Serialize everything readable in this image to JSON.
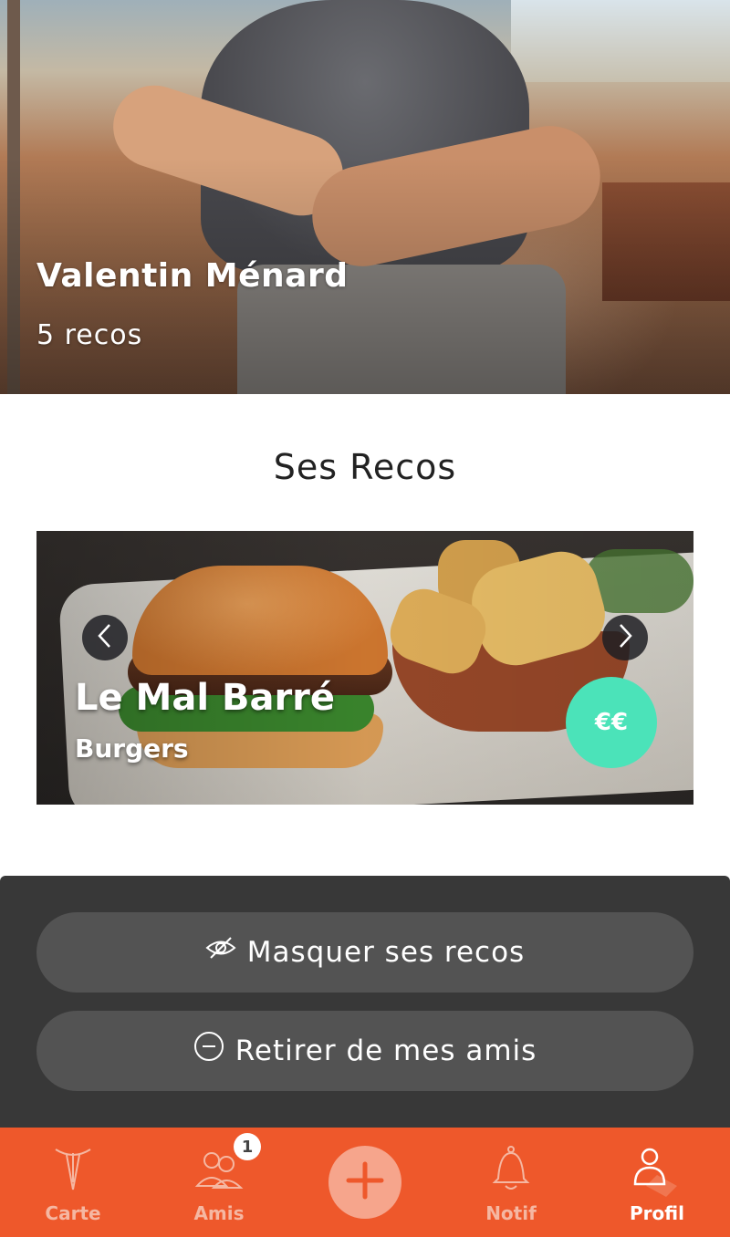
{
  "profile": {
    "name": "Valentin Ménard",
    "reco_count": "5 recos"
  },
  "section": {
    "title": "Ses Recos"
  },
  "recos": {
    "current": {
      "name": "Le Mal Barré",
      "category": "Burgers",
      "price": "€€"
    },
    "icons": {
      "prev": "chevron-left-icon",
      "next": "chevron-right-icon"
    }
  },
  "actions": {
    "hide_label": "Masquer ses recos",
    "remove_label": "Retirer de mes amis",
    "hide_icon": "eye-off-icon",
    "remove_icon": "minus-circle-icon"
  },
  "tabbar": {
    "items": [
      {
        "label": "Carte",
        "icon": "map-pin-icon"
      },
      {
        "label": "Amis",
        "icon": "friends-icon",
        "badge": "1"
      },
      {
        "label": "",
        "icon": "plus-icon"
      },
      {
        "label": "Notif",
        "icon": "bell-icon"
      },
      {
        "label": "Profil",
        "icon": "user-icon",
        "active": true
      }
    ]
  },
  "colors": {
    "accent": "#ee582b",
    "price_badge": "#4be3b9",
    "panel": "#383838",
    "button": "#535353"
  }
}
